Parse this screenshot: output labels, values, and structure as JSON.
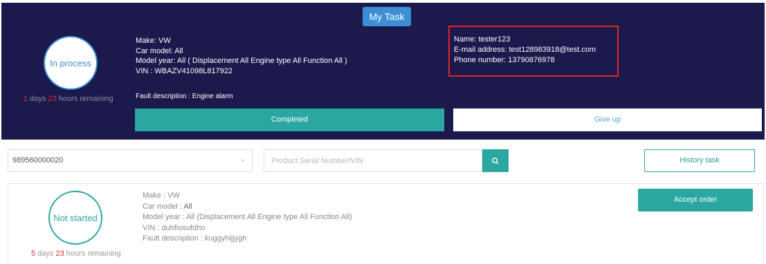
{
  "current_task": {
    "title": "My Task",
    "status": "In process",
    "remaining": {
      "days": "1",
      "days_text": " days ",
      "hours": "23",
      "hours_text": " hours remaining"
    },
    "make": "Make: VW",
    "car_model": "Car model: All",
    "model_year": "Model year: All ( Displacement All Engine type All Function All )",
    "vin": "VIN : WBAZV41098L817922",
    "fault": "Fault description : Engine alarm",
    "contact": {
      "name": "Name: tester123",
      "email": "E-mail address: test128983918@test.com",
      "phone": "Phone number: 13790876978"
    },
    "completed_label": "Completed",
    "giveup_label": "Give up"
  },
  "search": {
    "device_value": "989560000020",
    "placeholder": "Product Serial Number/VIN",
    "history_label": "History task"
  },
  "order": {
    "status": "Not started",
    "remaining": {
      "days": "5",
      "days_text": " days ",
      "hours": "23",
      "hours_text": " hours remaining"
    },
    "make": "Make : VW",
    "car_model_label": "Car model : ",
    "car_model_value": "All",
    "model_year": "Model year : All (Displacement All Engine type All Function All)",
    "vin": "VIN : duhfiosufdho",
    "fault": "Fault description : kuggyhijjygh",
    "accept_label": "Accept order"
  },
  "colors": {
    "panel_bg": "#1c1a4d",
    "accent_teal": "#2aa7a0",
    "accent_blue": "#3d8ed5",
    "highlight_red": "#e02424",
    "countdown_red": "#e02d2d"
  },
  "icons": {
    "search": "search-icon",
    "chevron": "chevron-down-icon"
  }
}
